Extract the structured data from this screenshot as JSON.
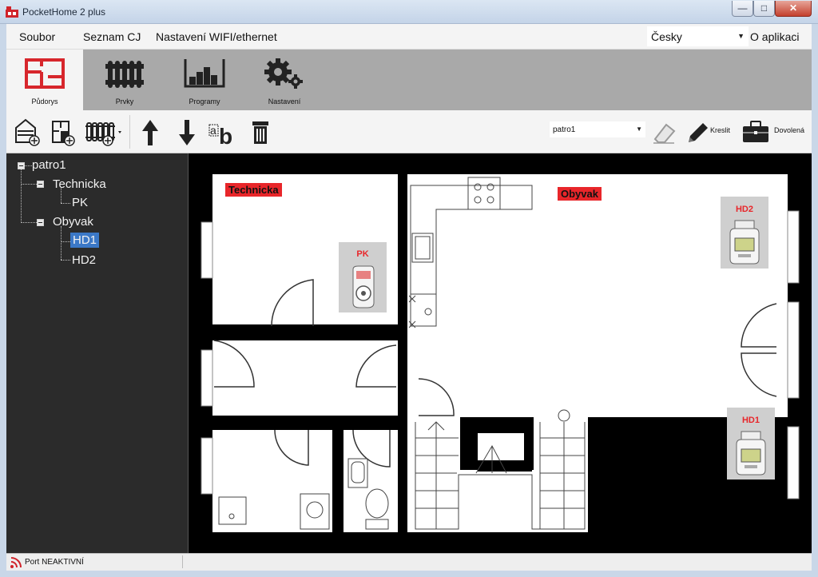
{
  "window": {
    "title": "PocketHome 2 plus",
    "minimize": "—",
    "maximize": "□",
    "close": "✕"
  },
  "menu": {
    "items": [
      "Soubor",
      "Seznam CJ",
      "Nastavení WIFI/ethernet"
    ],
    "language": "Česky",
    "about": "O aplikaci"
  },
  "ribbon": {
    "tabs": [
      {
        "label": "Půdorys",
        "icon": "floorplan-icon",
        "active": true
      },
      {
        "label": "Prvky",
        "icon": "radiator-icon",
        "active": false
      },
      {
        "label": "Programy",
        "icon": "chart-icon",
        "active": false
      },
      {
        "label": "Nastavení",
        "icon": "gears-icon",
        "active": false
      }
    ]
  },
  "toolbar": {
    "floor_select": "patro1",
    "draw_label": "Kreslit",
    "holiday_label": "Dovolená"
  },
  "tree": {
    "root": "patro1",
    "rooms": [
      {
        "name": "Technicka",
        "devices": [
          "PK"
        ]
      },
      {
        "name": "Obyvak",
        "devices": [
          "HD1",
          "HD2"
        ]
      }
    ],
    "selected": "HD1"
  },
  "plan": {
    "room_labels": [
      "Technicka",
      "Obyvak"
    ],
    "devices": [
      {
        "name": "PK",
        "type": "switch-plug"
      },
      {
        "name": "HD2",
        "type": "thermo-head"
      },
      {
        "name": "HD1",
        "type": "thermo-head"
      }
    ]
  },
  "status": {
    "port": "Port NEAKTIVNÍ"
  },
  "colors": {
    "accent": "#e8262a",
    "selection": "#3b78c7",
    "panel": "#2b2b2b"
  }
}
